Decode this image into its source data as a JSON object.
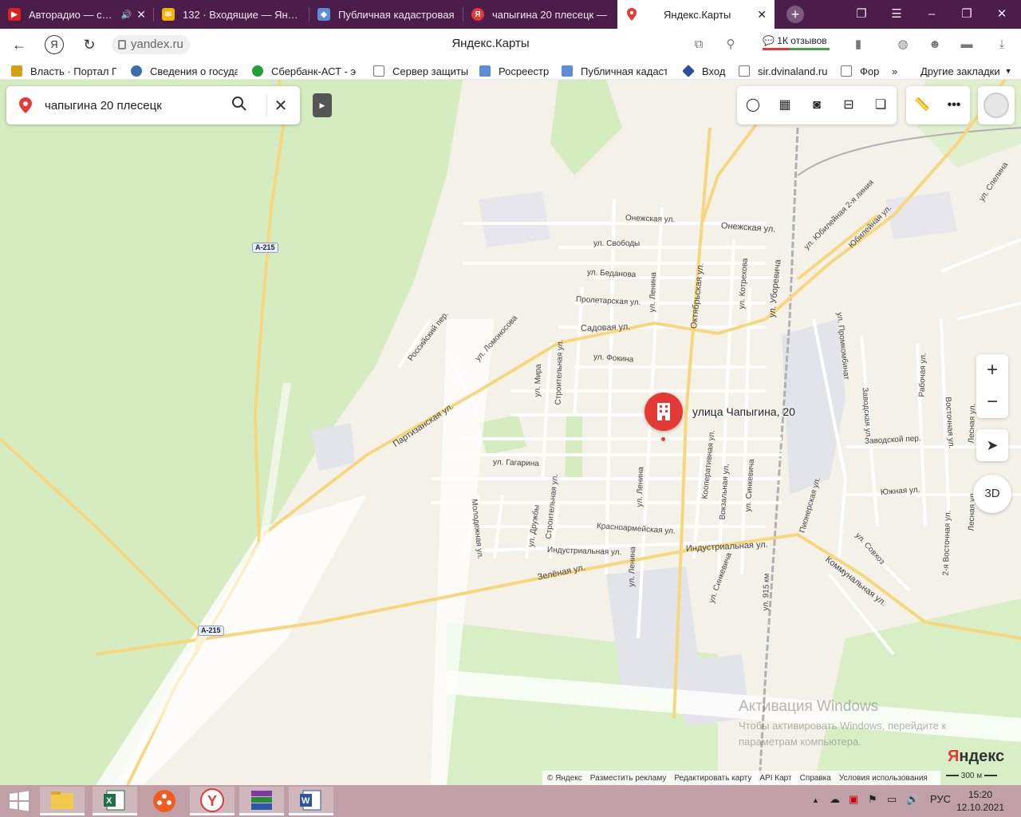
{
  "browser": {
    "tabs": [
      {
        "label": "Авторадио — слуш",
        "icon": "youtube-icon",
        "has_audio": true
      },
      {
        "label": "132 · Входящие — Яндек",
        "icon": "mail-icon"
      },
      {
        "label": "Публичная кадастровая",
        "icon": "cadastre-icon"
      },
      {
        "label": "чапыгина 20 плесецк — ",
        "icon": "yandex-search-icon"
      },
      {
        "label": "Яндекс.Карты",
        "icon": "yandex-maps-icon",
        "active": true
      }
    ],
    "window_buttons": [
      "bookmarks-panel-icon",
      "menu-icon",
      "minimize-icon",
      "restore-icon",
      "close-icon"
    ]
  },
  "addressbar": {
    "url": "yandex.ru",
    "title": "Яндекс.Карты",
    "reviews": "1К отзывов"
  },
  "bookmarks": [
    {
      "label": "Власть · Портал Пр"
    },
    {
      "label": "Сведения о госуда"
    },
    {
      "label": "Сбербанк-АСТ - э"
    },
    {
      "label": "Сервер защиты"
    },
    {
      "label": "Росреестр"
    },
    {
      "label": "Публичная кадаст"
    },
    {
      "label": "Вход"
    },
    {
      "label": "sir.dvinaland.ru"
    },
    {
      "label": "Фор"
    },
    {
      "label": "Другие закладки"
    }
  ],
  "map": {
    "search": {
      "value": "чапыгина 20 плесецк"
    },
    "road_badges": [
      "A-215",
      "A-215"
    ],
    "marker_label": "улица Чапыгина, 20",
    "streets": [
      {
        "name": "Онежская ул."
      },
      {
        "name": "Онежская ул."
      },
      {
        "name": "ул. Свободы"
      },
      {
        "name": "ул. Беданова"
      },
      {
        "name": "Пролетарская ул."
      },
      {
        "name": "Садовая ул."
      },
      {
        "name": "ул. Фокина"
      },
      {
        "name": "Российский пер."
      },
      {
        "name": "ул. Ломоносова"
      },
      {
        "name": "Партизанская ул."
      },
      {
        "name": "ул. Мира"
      },
      {
        "name": "Строительная ул."
      },
      {
        "name": "ул. Ленина"
      },
      {
        "name": "Октябрьская ул."
      },
      {
        "name": "ул. Котрехова"
      },
      {
        "name": "ул. Уборевича"
      },
      {
        "name": "ул. Юбилейная 2-я линия"
      },
      {
        "name": "Юбилейная ул."
      },
      {
        "name": "ул. Спелина"
      },
      {
        "name": "ул. Промкомбинат"
      },
      {
        "name": "Заводская ул."
      },
      {
        "name": "Рабочая ул."
      },
      {
        "name": "Восточная ул."
      },
      {
        "name": "Лесная ул."
      },
      {
        "name": "Заводской пер."
      },
      {
        "name": "ул. Гагарина"
      },
      {
        "name": "Молодежная ул."
      },
      {
        "name": "ул. Дружбы"
      },
      {
        "name": "Строительная ул."
      },
      {
        "name": "ул. Ленина"
      },
      {
        "name": "Кооперативная ул."
      },
      {
        "name": "Вокзальная ул."
      },
      {
        "name": "ул. Синкевича"
      },
      {
        "name": "Пионерская ул."
      },
      {
        "name": "Южная ул."
      },
      {
        "name": "Красноармейская ул."
      },
      {
        "name": "Индустриальная ул."
      },
      {
        "name": "Индустриальная ул."
      },
      {
        "name": "ул. Совхоз"
      },
      {
        "name": "Коммунальная ул."
      },
      {
        "name": "2-я Восточная ул."
      },
      {
        "name": "Лесная ул."
      },
      {
        "name": "Зелёная ул."
      },
      {
        "name": "ул. Ленина"
      },
      {
        "name": "ул. Синкевича"
      },
      {
        "name": "ул. 915 км"
      }
    ],
    "watermark": {
      "title": "Активация Windows",
      "body": "Чтобы активировать Windows, перейдите к параметрам компьютера."
    },
    "logo": {
      "first": "Я",
      "rest": "ндекс"
    },
    "footer": {
      "copyright": "© Яндекс",
      "links": [
        "Разместить рекламу",
        "Редактировать карту",
        "API Карт",
        "Справка",
        "Условия использования"
      ],
      "scale": "300 м"
    },
    "controls": {
      "zoom_in": "+",
      "zoom_out": "−",
      "three_d": "3D"
    }
  },
  "taskbar": {
    "apps": [
      "windows-start-icon",
      "file-explorer-icon",
      "excel-icon",
      "media-player-icon",
      "yandex-browser-icon",
      "winrar-icon",
      "word-icon"
    ],
    "language": "РУС",
    "time": "15:20",
    "date": "12.10.2021"
  },
  "colors": {
    "tab_strip": "#4b1d4b",
    "map_base": "#f4f1e8",
    "forest": "#d4ecc0",
    "road_major": "#f7d77e",
    "marker": "#e53935",
    "taskbar": "#c09fa6"
  }
}
